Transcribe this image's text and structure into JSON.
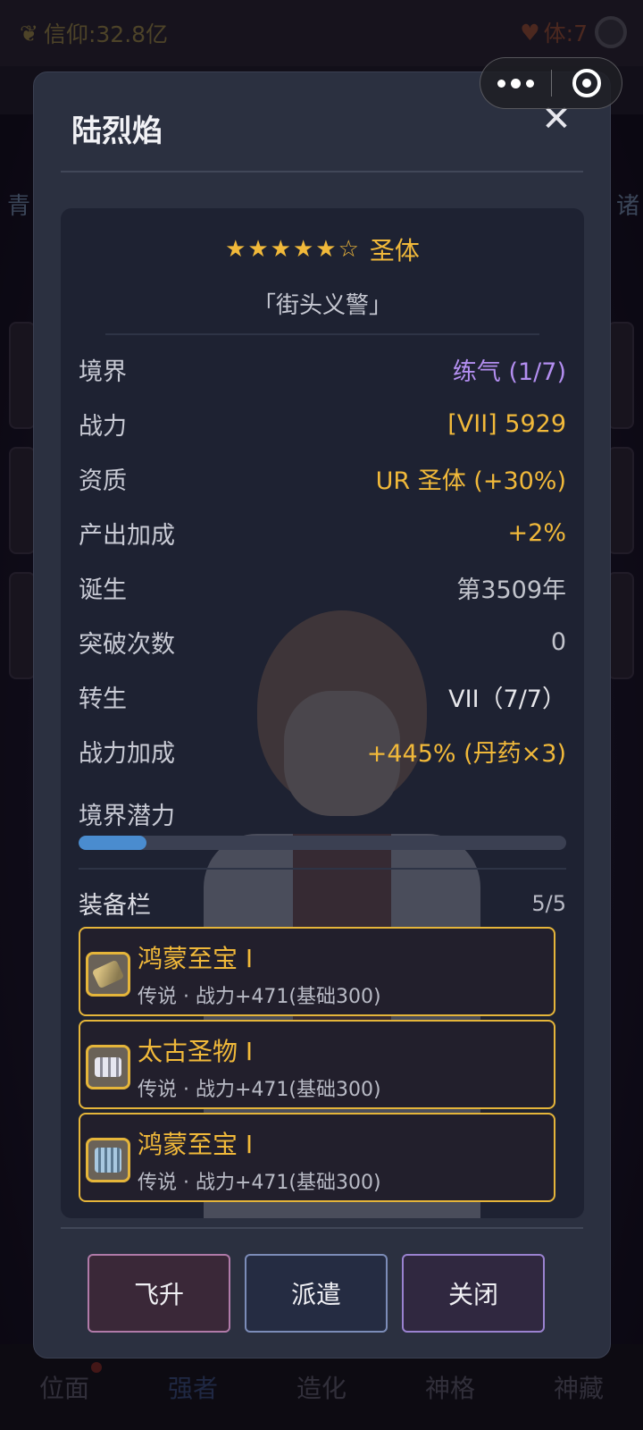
{
  "background": {
    "currency_label": "信仰:32.8亿",
    "stamina_label": "体:7",
    "left_edge_char": "青",
    "right_edge_char": "诸"
  },
  "capsule": {
    "more_icon": "more-dots-icon",
    "close_icon": "target-close-icon"
  },
  "modal": {
    "title": "陆烈焰",
    "close_glyph": "✕",
    "stars": "★★★★★☆",
    "grade": "圣体",
    "epithet": "「街头义警」",
    "stats": [
      {
        "key": "境界",
        "value": "练气 (1/7)"
      },
      {
        "key": "战力",
        "value": "[VII] 5929"
      },
      {
        "key": "资质",
        "value": "UR 圣体 (+30%)"
      },
      {
        "key": "产出加成",
        "value": "+2%"
      },
      {
        "key": "诞生",
        "value": "第3509年"
      },
      {
        "key": "突破次数",
        "value": "0"
      },
      {
        "key": "转生",
        "value": "VII（7/7）"
      },
      {
        "key": "战力加成",
        "value": "+445% (丹药×3)"
      }
    ],
    "potential_label": "境界潜力",
    "potential_progress": 0.14,
    "equipment": {
      "title": "装备栏",
      "count": "5/5",
      "items": [
        {
          "name": "鸿蒙至宝 I",
          "desc": "传说 · 战力+471(基础300)",
          "icon": "feather-icon"
        },
        {
          "name": "太古圣物 I",
          "desc": "传说 · 战力+471(基础300)",
          "icon": "gem-cluster-icon"
        },
        {
          "name": "鸿蒙至宝 I",
          "desc": "传说 · 战力+471(基础300)",
          "icon": "scroll-icon"
        }
      ]
    },
    "buttons": {
      "ascend": "飞升",
      "dispatch": "派遣",
      "close": "关闭"
    }
  },
  "bottom_nav": {
    "items": [
      "位面",
      "强者",
      "造化",
      "神格",
      "神藏"
    ],
    "active": "强者"
  },
  "colors": {
    "gold": "#f1b93a",
    "purple": "#b38ef0",
    "progress": "#4a8ccf"
  }
}
